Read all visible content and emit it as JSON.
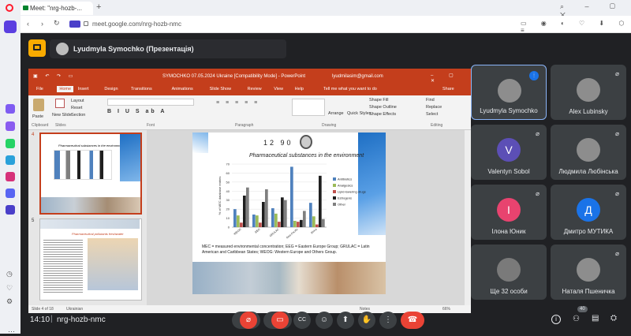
{
  "browser": {
    "tab_title": "Meet: \"nrg-hozb-...",
    "url": "meet.google.com/nrg-hozb-nmc"
  },
  "meet": {
    "presenter_label": "Lyudmyla Symochko (Презентація)",
    "time": "14:10",
    "meeting_code": "nrg-hozb-nmc",
    "people_count": "40",
    "participants": [
      {
        "name": "Lyudmyla Symochko",
        "initial": "",
        "color": "#3c4043"
      },
      {
        "name": "Alex Lubinsky",
        "initial": "",
        "color": "#3c4043"
      },
      {
        "name": "Valentyn Sobol",
        "initial": "V",
        "color": "#5c4fb6"
      },
      {
        "name": "Людмила Любінська",
        "initial": "",
        "color": "#3c4043"
      },
      {
        "name": "Ілона Юник",
        "initial": "І",
        "color": "#e8436f"
      },
      {
        "name": "Дмитро МУТИКА",
        "initial": "Д",
        "color": "#1a73e8"
      },
      {
        "name": "Ще 32 особи",
        "initial": "",
        "color": "#3c4043"
      },
      {
        "name": "Наталя Пшеничка",
        "initial": "",
        "color": "#3c4043"
      }
    ]
  },
  "ppt": {
    "title_bar": "SYMOCHKO 07.05.2024 Ukraine [Compatibility Mode] - PowerPoint",
    "user": "lyudmilasim@gmail.com",
    "menu": [
      "File",
      "Home",
      "Insert",
      "Design",
      "Transitions",
      "Animations",
      "Slide Show",
      "Review",
      "View",
      "Help"
    ],
    "tell_me": "Tell me what you want to do",
    "share": "Share",
    "ribbon_groups": [
      "Clipboard",
      "Slides",
      "Font",
      "Paragraph",
      "Drawing",
      "Editing"
    ],
    "ribbon_items": {
      "paste": "Paste",
      "new_slide": "New Slide",
      "layout": "Layout",
      "reset": "Reset",
      "section": "Section",
      "arrange": "Arrange",
      "quick_styles": "Quick Styles",
      "shape_fill": "Shape Fill",
      "shape_outline": "Shape Outline",
      "shape_effects": "Shape Effects",
      "find": "Find",
      "replace": "Replace",
      "select": "Select"
    },
    "thumb_numbers": [
      "4",
      "5"
    ],
    "thumb_titles": [
      "Pharmaceutical substances in the environment",
      "Pharmaceutical pollutants freshwater"
    ],
    "slide_number": "12 90",
    "status_left": "Slide 4 of 18",
    "status_lang": "Ukrainian",
    "status_notes": "Notes",
    "status_zoom": "66%",
    "slide_caption": "MEC = measured environmental concentration; EEG = Eastern Europe Group; GRULAC = Latin American and Caribbean States; WEOG: Western Europe and Others Group."
  },
  "chart_data": {
    "type": "bar",
    "title": "Pharmaceutical substances in the environment",
    "ylabel": "% of MEC database entries",
    "ylim": [
      0,
      70
    ],
    "yticks": [
      0,
      10,
      20,
      30,
      40,
      50,
      60,
      70
    ],
    "categories": [
      "WEOG",
      "EEG",
      "GRULAC",
      "Asia-Pacific",
      "Africa"
    ],
    "series": [
      {
        "name": "Antibiotics",
        "color": "#4f81bd",
        "values": [
          20,
          14,
          21,
          67,
          27
        ]
      },
      {
        "name": "Analgesics",
        "color": "#9bbb59",
        "values": [
          13,
          13,
          15,
          7,
          12
        ]
      },
      {
        "name": "Lipid-lowering drugs",
        "color": "#c0504d",
        "values": [
          5,
          5,
          6,
          6,
          3
        ]
      },
      {
        "name": "Estrogens",
        "color": "#1f1f1f",
        "values": [
          35,
          28,
          33,
          8,
          57
        ]
      },
      {
        "name": "Other",
        "color": "#7f7f7f",
        "values": [
          44,
          42,
          30,
          18,
          9
        ]
      }
    ]
  }
}
